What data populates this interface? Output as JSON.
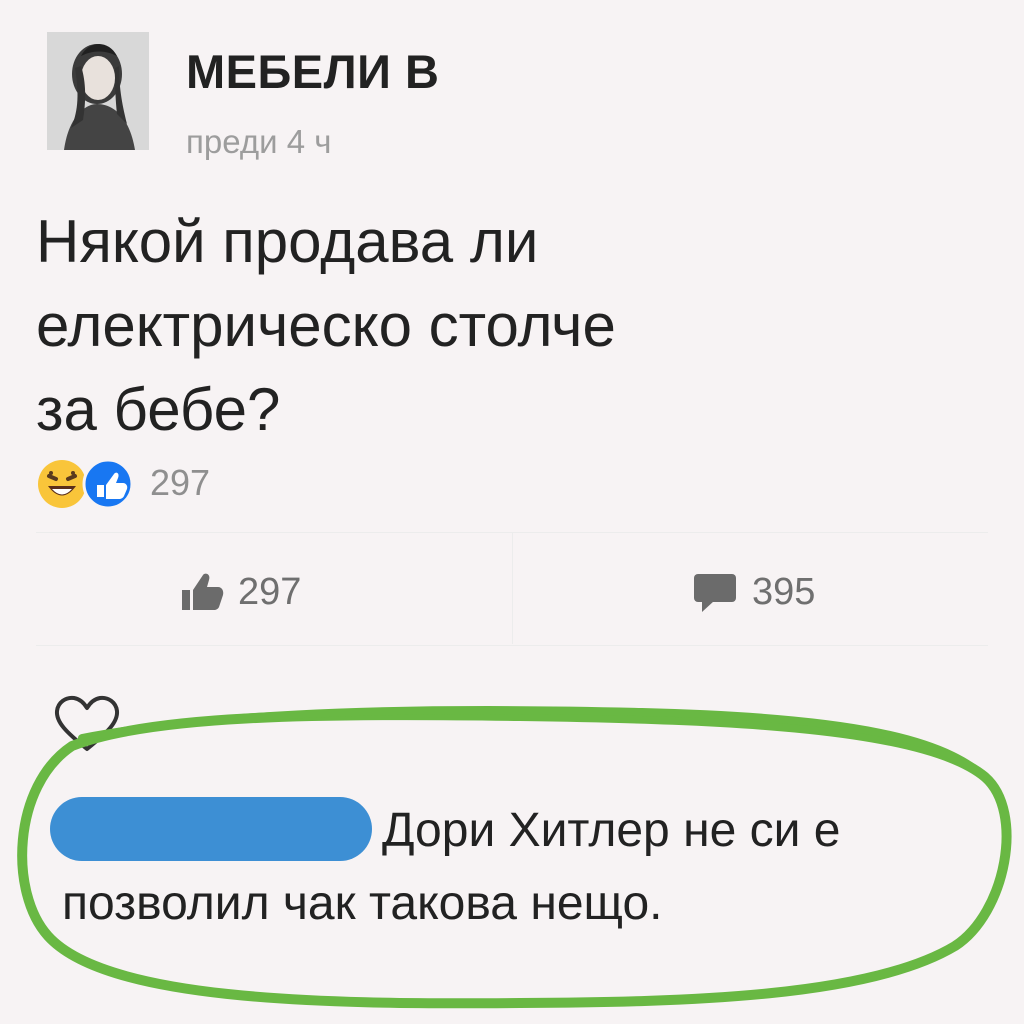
{
  "post": {
    "author": "МЕБЕЛИ В",
    "time": "преди 4 ч",
    "text_lines": [
      "Някой продава ли",
      "електрическо столче",
      "за бебе?"
    ]
  },
  "reactions": {
    "icons": [
      "laughing-face-icon",
      "thumbs-up-icon"
    ],
    "count": "297"
  },
  "actions": {
    "like_count": "297",
    "comment_count": "395"
  },
  "comment": {
    "line1": "Дори Хитлер не си е",
    "line2": "позволил чак такова нещо."
  },
  "colors": {
    "background": "#f7f3f4",
    "highlight_green": "#69b843",
    "name_redaction": "#3d8fd4",
    "like_blue": "#1877f2"
  }
}
